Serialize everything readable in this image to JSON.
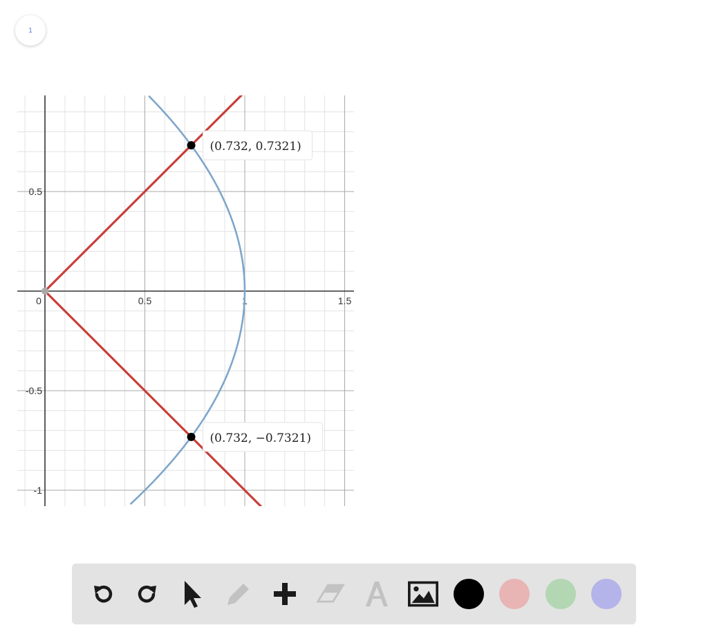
{
  "page": {
    "number": "1"
  },
  "chart_data": {
    "type": "line",
    "title": "",
    "xlabel": "",
    "ylabel": "",
    "xlim": [
      -0.11,
      1.55
    ],
    "ylim": [
      -1.07,
      0.98
    ],
    "grid": true,
    "x_ticks": [
      {
        "value": 0,
        "label": "0"
      },
      {
        "value": 0.5,
        "label": "0.5"
      },
      {
        "value": 1,
        "label": "1"
      },
      {
        "value": 1.5,
        "label": "1.5"
      }
    ],
    "y_ticks": [
      {
        "value": 0.5,
        "label": "0.5"
      },
      {
        "value": -0.5,
        "label": "-0.5"
      },
      {
        "value": -1,
        "label": "-1"
      }
    ],
    "series": [
      {
        "kind": "line",
        "color": "#c83e3a",
        "points": [
          [
            0,
            0
          ],
          [
            0.985,
            0.985
          ]
        ]
      },
      {
        "kind": "line",
        "color": "#c83e3a",
        "points": [
          [
            0,
            0
          ],
          [
            1.08,
            -1.08
          ]
        ]
      },
      {
        "kind": "curve",
        "color": "#7ea6cb",
        "function": "x = 1 - 0.5*y^2",
        "y_range": [
          -1.07,
          0.98
        ]
      }
    ],
    "points": [
      {
        "x": 0.732,
        "y": 0.7321,
        "label": "(0.732, 0.7321)",
        "color": "#000000"
      },
      {
        "x": 0.732,
        "y": -0.7321,
        "label": "(0.732, −0.7321)",
        "color": "#000000"
      },
      {
        "x": 0,
        "y": 0,
        "label": "",
        "color": "#aaaaaa"
      }
    ]
  },
  "toolbar": {
    "tools": [
      {
        "name": "undo-icon",
        "enabled": true
      },
      {
        "name": "redo-icon",
        "enabled": true
      },
      {
        "name": "pointer-icon",
        "enabled": true
      },
      {
        "name": "pencil-icon",
        "enabled": false
      },
      {
        "name": "add-icon",
        "enabled": true
      },
      {
        "name": "eraser-icon",
        "enabled": false
      },
      {
        "name": "text-icon",
        "enabled": false
      },
      {
        "name": "image-icon",
        "enabled": true
      }
    ],
    "colors": [
      "#000000",
      "#e8b4b4",
      "#b3d6b3",
      "#b4b4ea"
    ]
  }
}
